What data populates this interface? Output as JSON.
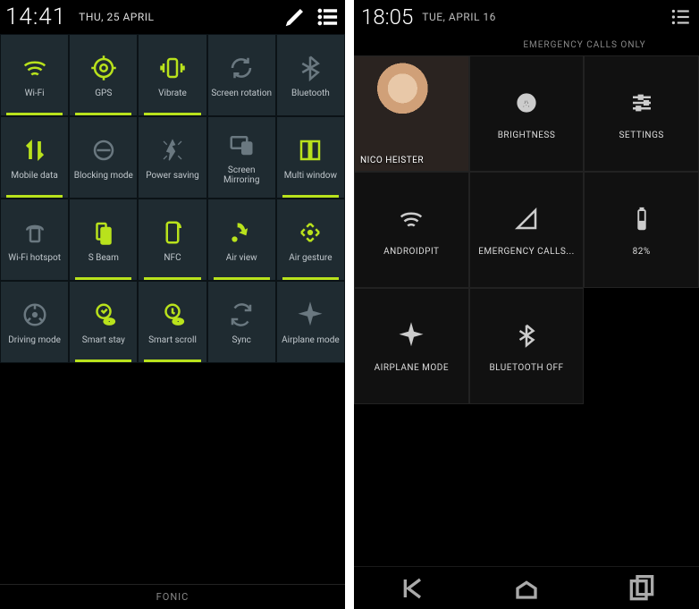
{
  "left": {
    "status": {
      "clock": "14:41",
      "date": "THU, 25 APRIL"
    },
    "footer": "FONIC",
    "tiles": [
      {
        "name": "wifi",
        "label": "Wi-Fi",
        "active": true
      },
      {
        "name": "gps",
        "label": "GPS",
        "active": true
      },
      {
        "name": "vibrate",
        "label": "Vibrate",
        "active": true
      },
      {
        "name": "screen-rotation",
        "label": "Screen rotation",
        "active": false
      },
      {
        "name": "bluetooth",
        "label": "Bluetooth",
        "active": false
      },
      {
        "name": "mobile-data",
        "label": "Mobile data",
        "active": true
      },
      {
        "name": "blocking-mode",
        "label": "Blocking mode",
        "active": false
      },
      {
        "name": "power-saving",
        "label": "Power saving",
        "active": false
      },
      {
        "name": "screen-mirroring",
        "label": "Screen Mirroring",
        "active": false
      },
      {
        "name": "multi-window",
        "label": "Multi window",
        "active": true
      },
      {
        "name": "wifi-hotspot",
        "label": "Wi-Fi hotspot",
        "active": false
      },
      {
        "name": "s-beam",
        "label": "S Beam",
        "active": true
      },
      {
        "name": "nfc",
        "label": "NFC",
        "active": true
      },
      {
        "name": "air-view",
        "label": "Air view",
        "active": true
      },
      {
        "name": "air-gesture",
        "label": "Air gesture",
        "active": true
      },
      {
        "name": "driving-mode",
        "label": "Driving mode",
        "active": false
      },
      {
        "name": "smart-stay",
        "label": "Smart stay",
        "active": true
      },
      {
        "name": "smart-scroll",
        "label": "Smart scroll",
        "active": true
      },
      {
        "name": "sync",
        "label": "Sync",
        "active": false
      },
      {
        "name": "airplane-mode",
        "label": "Airplane mode",
        "active": false
      }
    ]
  },
  "right": {
    "status": {
      "clock": "18:05",
      "date": "TUE, APRIL 16"
    },
    "banner": "EMERGENCY CALLS ONLY",
    "user_name": "NICO HEISTER",
    "tiles": [
      {
        "name": "brightness",
        "label": "BRIGHTNESS"
      },
      {
        "name": "settings",
        "label": "SETTINGS"
      },
      {
        "name": "wifi",
        "label": "ANDROIDPIT"
      },
      {
        "name": "signal",
        "label": "EMERGENCY CALLS..."
      },
      {
        "name": "battery",
        "label": "82%"
      },
      {
        "name": "airplane",
        "label": "AIRPLANE MODE"
      },
      {
        "name": "bluetooth-off",
        "label": "BLUETOOTH OFF"
      }
    ]
  }
}
